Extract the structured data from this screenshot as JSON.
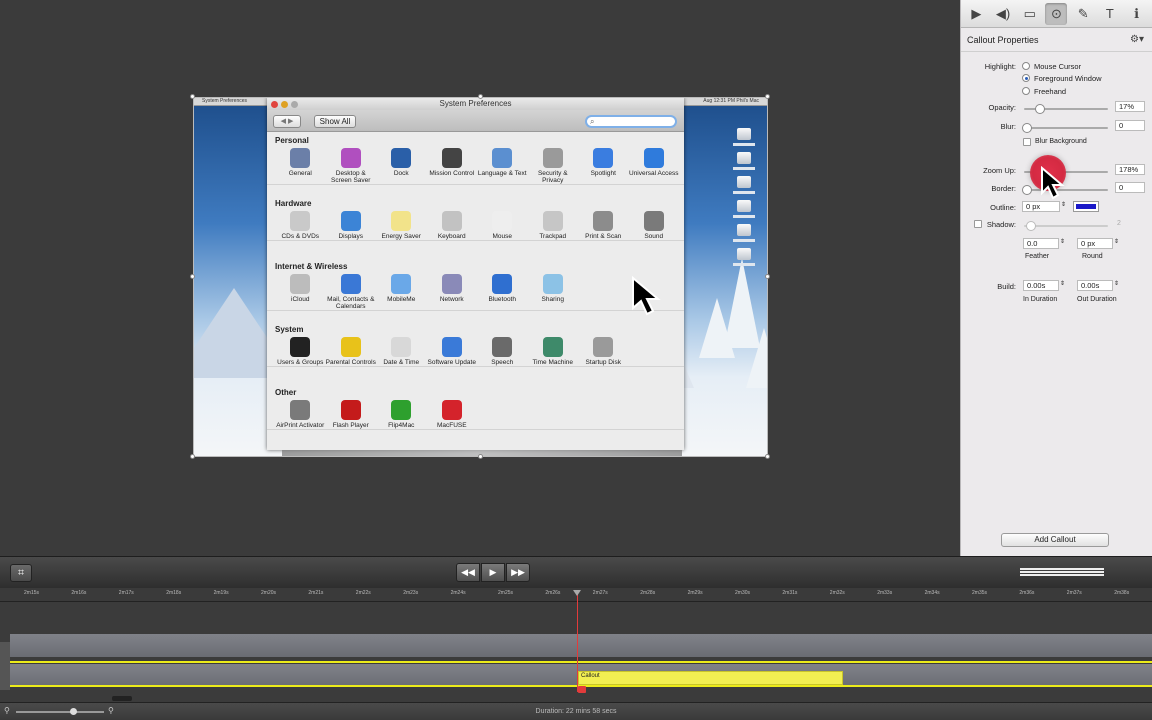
{
  "screen_title": "System Preferences",
  "screen_menubar": {
    "left": "System Preferences",
    "right": "Aug 12:31 PM  Phil's Mac"
  },
  "prefs": {
    "title": "System Preferences",
    "show_all": "Show All",
    "sections": [
      {
        "name": "Personal",
        "items": [
          {
            "label": "General",
            "icon": "general-icon",
            "color": "#6b7fa8"
          },
          {
            "label": "Desktop & Screen Saver",
            "icon": "desktop-icon",
            "color": "#b04fbf"
          },
          {
            "label": "Dock",
            "icon": "dock-icon",
            "color": "#2a5fa8"
          },
          {
            "label": "Mission Control",
            "icon": "mission-control-icon",
            "color": "#444444"
          },
          {
            "label": "Language & Text",
            "icon": "flag-icon",
            "color": "#5b8fd0"
          },
          {
            "label": "Security & Privacy",
            "icon": "house-lock-icon",
            "color": "#9a9a9a"
          },
          {
            "label": "Spotlight",
            "icon": "spotlight-icon",
            "color": "#3a7de0"
          },
          {
            "label": "Universal Access",
            "icon": "accessibility-icon",
            "color": "#2f7bdc"
          }
        ]
      },
      {
        "name": "Hardware",
        "items": [
          {
            "label": "CDs & DVDs",
            "icon": "disc-icon",
            "color": "#c9c9c9"
          },
          {
            "label": "Displays",
            "icon": "display-icon",
            "color": "#3c84d6"
          },
          {
            "label": "Energy Saver",
            "icon": "bulb-icon",
            "color": "#f2e38a"
          },
          {
            "label": "Keyboard",
            "icon": "keyboard-icon",
            "color": "#c2c2c2"
          },
          {
            "label": "Mouse",
            "icon": "mouse-icon",
            "color": "#eeeeee"
          },
          {
            "label": "Trackpad",
            "icon": "trackpad-icon",
            "color": "#c6c6c6"
          },
          {
            "label": "Print & Scan",
            "icon": "printer-icon",
            "color": "#8c8c8c"
          },
          {
            "label": "Sound",
            "icon": "speaker-icon",
            "color": "#7a7a7a"
          }
        ]
      },
      {
        "name": "Internet & Wireless",
        "items": [
          {
            "label": "iCloud",
            "icon": "cloud-icon",
            "color": "#bcbcbc"
          },
          {
            "label": "Mail, Contacts & Calendars",
            "icon": "at-icon",
            "color": "#3a78d6"
          },
          {
            "label": "MobileMe",
            "icon": "mobileme-icon",
            "color": "#6aa8e8"
          },
          {
            "label": "Network",
            "icon": "globe-icon",
            "color": "#8a8ab8"
          },
          {
            "label": "Bluetooth",
            "icon": "bluetooth-icon",
            "color": "#2f6fd0"
          },
          {
            "label": "Sharing",
            "icon": "folder-icon",
            "color": "#8cc2e6"
          }
        ]
      },
      {
        "name": "System",
        "items": [
          {
            "label": "Users & Groups",
            "icon": "users-icon",
            "color": "#222222"
          },
          {
            "label": "Parental Controls",
            "icon": "parental-icon",
            "color": "#e8c21a"
          },
          {
            "label": "Date & Time",
            "icon": "clock-icon",
            "color": "#d8d8d8"
          },
          {
            "label": "Software Update",
            "icon": "update-icon",
            "color": "#3a7ad8"
          },
          {
            "label": "Speech",
            "icon": "microphone-icon",
            "color": "#6a6a6a"
          },
          {
            "label": "Time Machine",
            "icon": "time-machine-icon",
            "color": "#3e8a6a"
          },
          {
            "label": "Startup Disk",
            "icon": "disk-icon",
            "color": "#9a9a9a"
          }
        ]
      },
      {
        "name": "Other",
        "items": [
          {
            "label": "AirPrint Activator",
            "icon": "printer-icon",
            "color": "#7a7a7a"
          },
          {
            "label": "Flash Player",
            "icon": "flash-icon",
            "color": "#c41b1b"
          },
          {
            "label": "Flip4Mac",
            "icon": "flip4mac-icon",
            "color": "#2ea02e"
          },
          {
            "label": "MacFUSE",
            "icon": "macfuse-icon",
            "color": "#d4232b"
          }
        ]
      }
    ]
  },
  "panel": {
    "title": "Callout Properties",
    "highlight_label": "Highlight:",
    "highlight_options": [
      "Mouse Cursor",
      "Foreground Window",
      "Freehand"
    ],
    "highlight_selected": "Foreground Window",
    "opacity_label": "Opacity:",
    "opacity_value": "17%",
    "opacity_level": 0.17,
    "blur_label": "Blur:",
    "blur_value": "0",
    "blur_bg_label": "Blur Background",
    "zoom_label": "Zoom Up:",
    "zoom_value": "178%",
    "border_label": "Border:",
    "border_value": "0",
    "outline_label": "Outline:",
    "outline_value": "0 px",
    "outline_color": "#1a18c8",
    "shadow_label": "Shadow:",
    "shadow_value": "2",
    "feather_value": "0.0",
    "round_value": "0 px",
    "feather_label": "Feather",
    "round_label": "Round",
    "build_label": "Build:",
    "in_value": "0.00s",
    "out_value": "0.00s",
    "in_label": "In Duration",
    "out_label": "Out Duration",
    "add_callout": "Add Callout"
  },
  "timeline": {
    "ruler": [
      "2m15s",
      "2m16s",
      "2m17s",
      "2m18s",
      "2m19s",
      "2m20s",
      "2m21s",
      "2m22s",
      "2m23s",
      "2m24s",
      "2m25s",
      "2m26s",
      "2m27s",
      "2m28s",
      "2m29s",
      "2m30s",
      "2m31s",
      "2m32s",
      "2m33s",
      "2m34s",
      "2m35s",
      "2m36s",
      "2m37s",
      "2m38s"
    ],
    "clip_label": "Callout",
    "duration": "Duration: 22 mins 58 secs"
  },
  "colors": {
    "playhead": "#e23b3b",
    "callout_clip": "#f2ef52",
    "audio_line": "#ecec1a"
  }
}
